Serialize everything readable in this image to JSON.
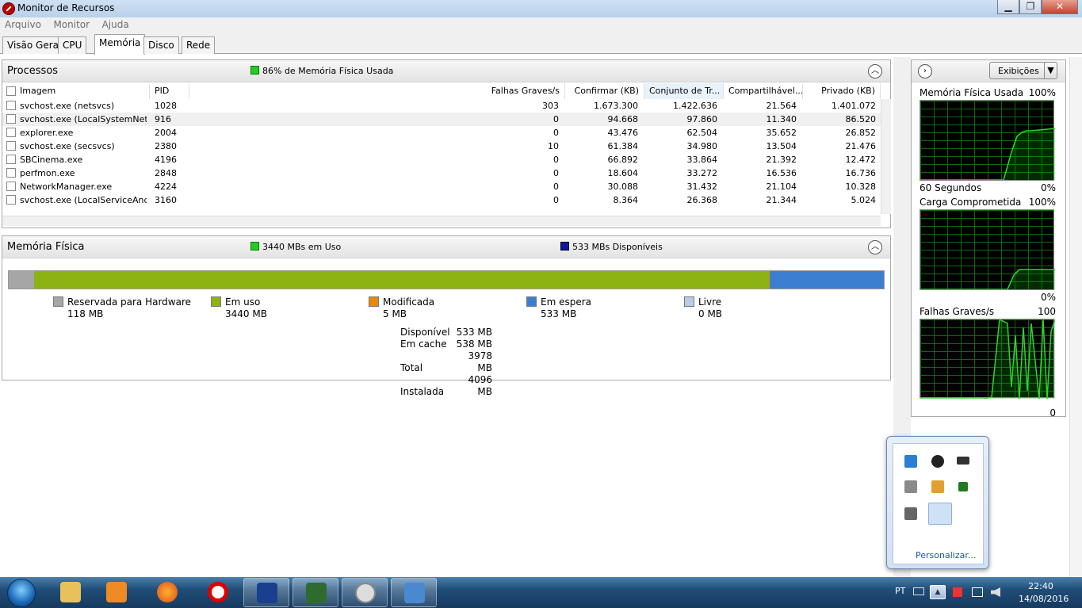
{
  "window": {
    "title": "Monitor de Recursos",
    "minimize": "▁",
    "maximize": "❐",
    "close": "✕"
  },
  "menu": [
    "Arquivo",
    "Monitor",
    "Ajuda"
  ],
  "tabs": [
    "Visão Geral",
    "CPU",
    "Memória",
    "Disco",
    "Rede"
  ],
  "active_tab": "Memória",
  "processes": {
    "title": "Processos",
    "summary": "86% de Memória Física Usada",
    "summary_color": "#22cc22",
    "columns": [
      "Imagem",
      "PID",
      "Falhas Graves/s",
      "Confirmar (KB)",
      "Conjunto de Tr...",
      "Compartilhável...",
      "Privado (KB)"
    ],
    "rows": [
      [
        "svchost.exe (netsvcs)",
        "1028",
        "303",
        "1.673.300",
        "1.422.636",
        "21.564",
        "1.401.072"
      ],
      [
        "svchost.exe (LocalSystemNet...",
        "916",
        "0",
        "94.668",
        "97.860",
        "11.340",
        "86.520"
      ],
      [
        "explorer.exe",
        "2004",
        "0",
        "43.476",
        "62.504",
        "35.652",
        "26.852"
      ],
      [
        "svchost.exe (secsvcs)",
        "2380",
        "10",
        "61.384",
        "34.980",
        "13.504",
        "21.476"
      ],
      [
        "SBCinema.exe",
        "4196",
        "0",
        "66.892",
        "33.864",
        "21.392",
        "12.472"
      ],
      [
        "perfmon.exe",
        "2848",
        "0",
        "18.604",
        "33.272",
        "16.536",
        "16.736"
      ],
      [
        "NetworkManager.exe",
        "4224",
        "0",
        "30.088",
        "31.432",
        "21.104",
        "10.328"
      ],
      [
        "svchost.exe (LocalServiceAnd...",
        "3160",
        "0",
        "8.364",
        "26.368",
        "21.344",
        "5.024"
      ]
    ]
  },
  "physical_memory": {
    "title": "Memória Física",
    "in_use_summary": "3440 MBs em Uso",
    "available_summary": "533 MBs Disponíveis",
    "in_use_color": "#22cc22",
    "available_color": "#0a1aa8",
    "bar": [
      {
        "value": 118,
        "color": "#a6a6a6"
      },
      {
        "value": 3440,
        "color": "#8db312"
      },
      {
        "value": 5,
        "color": "#e68a00"
      },
      {
        "value": 533,
        "color": "#3c7fd1"
      },
      {
        "value": 0,
        "color": "#b7cde6"
      }
    ],
    "legend": [
      {
        "label": "Reservada para Hardware",
        "value": "118 MB",
        "color": "#a6a6a6"
      },
      {
        "label": "Em uso",
        "value": "3440 MB",
        "color": "#8db312"
      },
      {
        "label": "Modificada",
        "value": "5 MB",
        "color": "#e68a00"
      },
      {
        "label": "Em espera",
        "value": "533 MB",
        "color": "#3c7fd1"
      },
      {
        "label": "Livre",
        "value": "0 MB",
        "color": "#b7cde6"
      }
    ],
    "stats": [
      {
        "label": "Disponível",
        "value": "533 MB"
      },
      {
        "label": "Em cache",
        "value": "538 MB"
      },
      {
        "label": "Total",
        "value": "3978 MB"
      },
      {
        "label": "Instalada",
        "value": "4096 MB"
      }
    ]
  },
  "side_panel": {
    "views_button": "Exibições",
    "graphs": [
      {
        "title": "Memória Física Usada",
        "max": "100%",
        "footer_left": "60 Segundos",
        "footer_right": "0%"
      },
      {
        "title": "Carga Comprometida",
        "max": "100%",
        "footer_left": "",
        "footer_right": "0%"
      },
      {
        "title": "Falhas Graves/s",
        "max": "100",
        "footer_left": "",
        "footer_right": "0"
      }
    ]
  },
  "tray_popup": {
    "link": "Personalizar..."
  },
  "taskbar": {
    "language": "PT",
    "time": "22:40",
    "date": "14/08/2016"
  }
}
